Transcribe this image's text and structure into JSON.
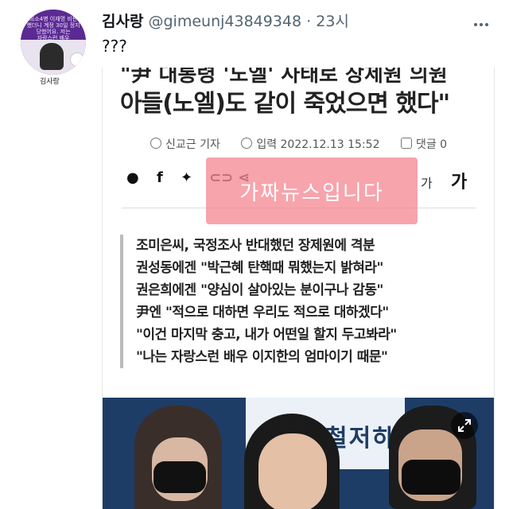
{
  "avatar": {
    "overlay_text": "최소4병 이재명 비판\n했더니 계정 30일 정지\n당했어요. 저는\n자랑스런 배우",
    "name_label": "김사랑"
  },
  "tweet": {
    "display_name": "김사랑",
    "handle": "@gimeunj43849348",
    "separator": "·",
    "time": "23시",
    "text": "???"
  },
  "article": {
    "headline_cut": "\"尹 대통령 '노엘' 사태로 장제원 의원",
    "headline": "아들(노엘)도 같이 죽었으면 했다\"",
    "meta": {
      "author": "신교근 기자",
      "date": "입력 2022.12.13 15:52",
      "comments": "댓글 0"
    },
    "share_icons": [
      "speech-bubble-icon",
      "facebook-icon",
      "twitter-icon",
      "link-icon",
      "share-icon"
    ],
    "font_small": "가",
    "font_big": "가",
    "stamp": "가짜뉴스입니다",
    "subheads": [
      "조미은씨, 국정조사 반대했던 장제원에 격분",
      "권성동에겐 \"박근혜 탄핵때 뭐했는지 밝혀라\"",
      "권은희에겐 \"양심이 살아있는 분이구나 감동\"",
      "尹엔 \"적으로 대하면 우리도 적으로 대하겠다\"",
      "\"이건 마지막 충고, 내가 어떤일 할지 두고봐라\"",
      "\"나는 자랑스런 배우 이지한의 엄마이기 때문\""
    ],
    "photo_banner": "철저하"
  },
  "colors": {
    "stamp": "#f58a96",
    "avatar": "#5b2a92",
    "muted": "#536471"
  }
}
